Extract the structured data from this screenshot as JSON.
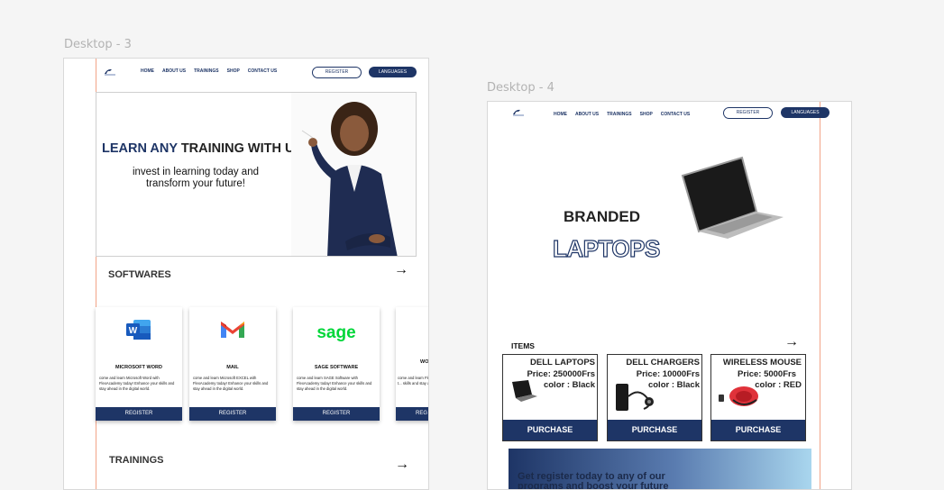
{
  "frames": [
    {
      "label": "Desktop - 3",
      "nav": [
        "HOME",
        "ABOUT US",
        "TRAININGS",
        "SHOP",
        "CONTACT US"
      ],
      "register_label": "REGISTER",
      "languages_label": "LANGUAGES",
      "hero": {
        "title_accent": "LEARN ANY",
        "title_rest": " TRAINING WITH US",
        "subtitle": "invest in learning today and transform your future!"
      },
      "softwares_title": "SOFTWARES",
      "cards": [
        {
          "title": "MICROSOFT WORD",
          "desc": "come and learn Microsoft Word with FlexAcademy today! Enhance your skills and stay ahead in the digital world.",
          "button": "REGISTER",
          "icon": "word-icon"
        },
        {
          "title": "MAIL",
          "desc": "come and learn Microsoft EXCEL with FlexAcademy today! Enhance your skills and stay ahead in the digital world.",
          "button": "REGISTER",
          "icon": "gmail-icon"
        },
        {
          "title": "SAGE SOFTWARE",
          "desc": "come and learn SAGE Software with FlexAcademy today! Enhance your skills and stay ahead in the digital world.",
          "button": "REGISTER",
          "icon": "sage-icon",
          "icon_text": "sage"
        },
        {
          "title": "WO",
          "desc": "come and learn FlexAcademy t... skills and stay a... world.",
          "button": "REG",
          "icon": ""
        }
      ],
      "trainings_title": "TRAININGS"
    },
    {
      "label": "Desktop - 4",
      "nav": [
        "HOME",
        "ABOUT US",
        "TRAININGS",
        "SHOP",
        "CONTACT US"
      ],
      "register_label": "REGISTER",
      "languages_label": "LANGUAGES",
      "hero": {
        "branded": "BRANDED",
        "laptops": "LAPTOPS"
      },
      "items_title": "ITEMS",
      "products": [
        {
          "name": "DELL LAPTOPS",
          "price": "Price: 250000Frs",
          "color": "color : Black",
          "button": "PURCHASE",
          "icon": "laptop-icon"
        },
        {
          "name": "DELL CHARGERS",
          "price": "Price: 10000Frs",
          "color": "color : Black",
          "button": "PURCHASE",
          "icon": "charger-icon"
        },
        {
          "name": "WIRELESS MOUSE",
          "price": "Price: 5000Frs",
          "color": "color : RED",
          "button": "PURCHASE",
          "icon": "mouse-icon"
        }
      ],
      "banner_text": "Get register today to any of our programs and boost your future"
    }
  ],
  "colors": {
    "navy": "#1e3566",
    "guide": "#f2a488",
    "word_blue": "#185abd",
    "sage_green": "#00d639",
    "gmail_red": "#ea4335",
    "mouse_red": "#e0323a"
  }
}
